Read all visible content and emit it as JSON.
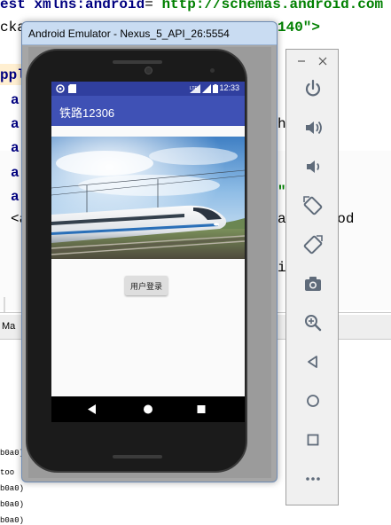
{
  "ide": {
    "code_lines": [
      {
        "a": "est ",
        "b": "xmlns:android",
        "c": "= ",
        "d": "http://schemas.android.com"
      },
      {
        "a": "ckag",
        "b": "",
        "c": "",
        "d": "140\">"
      },
      {
        "a": "ppl",
        "b": "",
        "c": "",
        "d": ""
      },
      {
        "a": "a",
        "b": "",
        "c": "",
        "d": ""
      },
      {
        "a": "a",
        "b": "",
        "c": "",
        "d": "h"
      },
      {
        "a": "a",
        "b": "",
        "c": "",
        "d": ""
      },
      {
        "a": "a",
        "b": "",
        "c": "",
        "d": ""
      },
      {
        "a": "a",
        "b": "",
        "c": "",
        "d": "\""
      },
      {
        "a": "<a",
        "b": "",
        "c": "",
        "d": "a.andriod"
      },
      {
        "a": "",
        "b": "",
        "c": "",
        "d": ""
      },
      {
        "a": "",
        "b": "",
        "c": "",
        "d": "intent"
      }
    ],
    "tab_label": "Ma",
    "log_lines": [
      "b0a0)",
      "too",
      "b0a0)",
      "b0a0)",
      "b0a0)"
    ]
  },
  "emulator": {
    "window_title": "Android Emulator - Nexus_5_API_26:5554"
  },
  "device": {
    "status_time": "12:33",
    "app_title": "铁路12306",
    "login_button": "用户登录",
    "colors": {
      "status_bar": "#303f9f",
      "app_bar": "#3f51b5",
      "screen_bg": "#fafafa"
    }
  },
  "toolbar": {
    "window_controls": [
      "minimize-icon",
      "close-icon"
    ],
    "buttons": [
      "power-icon",
      "volume-up-icon",
      "volume-down-icon",
      "rotate-left-icon",
      "rotate-right-icon",
      "camera-icon",
      "zoom-icon",
      "back-icon",
      "home-icon",
      "overview-icon",
      "more-icon"
    ]
  }
}
